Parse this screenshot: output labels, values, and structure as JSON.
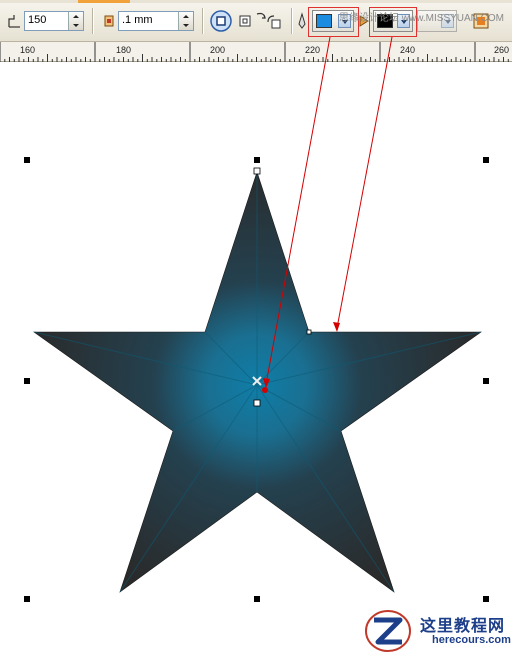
{
  "toolbar": {
    "star_points_value": "150",
    "outline_width_value": ".1 mm",
    "start_color": "#1a8de0",
    "end_color": "#000000",
    "watermark": "思缘设计论坛 www.MISSYUAN.COM",
    "icons": [
      "star-points-icon",
      "outline-width-icon",
      "node-icon",
      "square-icon",
      "rotate-icon",
      "copy-icon",
      "pen-icon",
      "palette-icon"
    ]
  },
  "ruler": {
    "labels": [
      "160",
      "180",
      "200",
      "220",
      "240",
      "260"
    ]
  },
  "canvas": {
    "star_fill_center": "#0f7ea8",
    "star_fill_edge": "#2a2a2a",
    "annotation_color": "#d40000"
  },
  "logo": {
    "title": "这里教程网",
    "url": "herecours.com"
  }
}
